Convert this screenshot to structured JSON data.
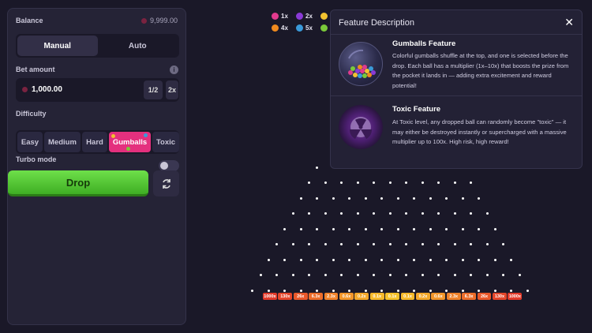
{
  "sidebar": {
    "balance_label": "Balance",
    "balance_value": "9,999.00",
    "mode_manual": "Manual",
    "mode_auto": "Auto",
    "bet_amount_label": "Bet amount",
    "bet_value": "1,000.00",
    "half_label": "1/2",
    "double_label": "2x",
    "difficulty_label": "Difficulty",
    "difficulties": [
      "Easy",
      "Medium",
      "Hard",
      "Gumballs",
      "Toxic"
    ],
    "selected_difficulty": "Gumballs",
    "turbo_label": "Turbo mode",
    "drop_label": "Drop",
    "colors": {
      "accent": "#e4307e",
      "drop": "#5fd13c"
    }
  },
  "legend": [
    {
      "label": "1x",
      "color": "#e23a8e"
    },
    {
      "label": "2x",
      "color": "#8a3ad6"
    },
    {
      "label": "",
      "color": "#f2c230"
    },
    {
      "label": "4x",
      "color": "#f08a1e"
    },
    {
      "label": "5x",
      "color": "#3a9ad9"
    },
    {
      "label": "",
      "color": "#7ac93a"
    }
  ],
  "popup": {
    "header": "Feature Description",
    "close_symbol": "✕",
    "features": [
      {
        "title": "Gumballs Feature",
        "text": "Colorful gumballs shuffle at the top, and one is selected before the drop. Each ball has a multiplier (1x–10x) that boosts the prize from the pocket it lands in — adding extra excitement and reward potential!"
      },
      {
        "title": "Toxic Feature",
        "text": "At Toxic level, any dropped ball can randomly become \"toxic\" — it may either be destroyed instantly or supercharged with a massive multiplier up to 100x. High risk, high reward!"
      }
    ]
  },
  "multipliers": [
    "1000x",
    "130x",
    "26x",
    "6.3x",
    "2.3x",
    "0.6x",
    "0.2x",
    "0.1x",
    "0.1x",
    "0.1x",
    "0.2x",
    "0.6x",
    "2.3x",
    "6.3x",
    "26x",
    "130x",
    "1000x"
  ],
  "multiplier_colors": [
    "#e23a2a",
    "#e4462a",
    "#e8582a",
    "#ec6d2a",
    "#ef822a",
    "#f2962a",
    "#f4a82a",
    "#f5b82a",
    "#f6c22a",
    "#f5b82a",
    "#f4a82a",
    "#f2962a",
    "#ef822a",
    "#ec6d2a",
    "#e8582a",
    "#e4462a",
    "#e23a2a"
  ]
}
